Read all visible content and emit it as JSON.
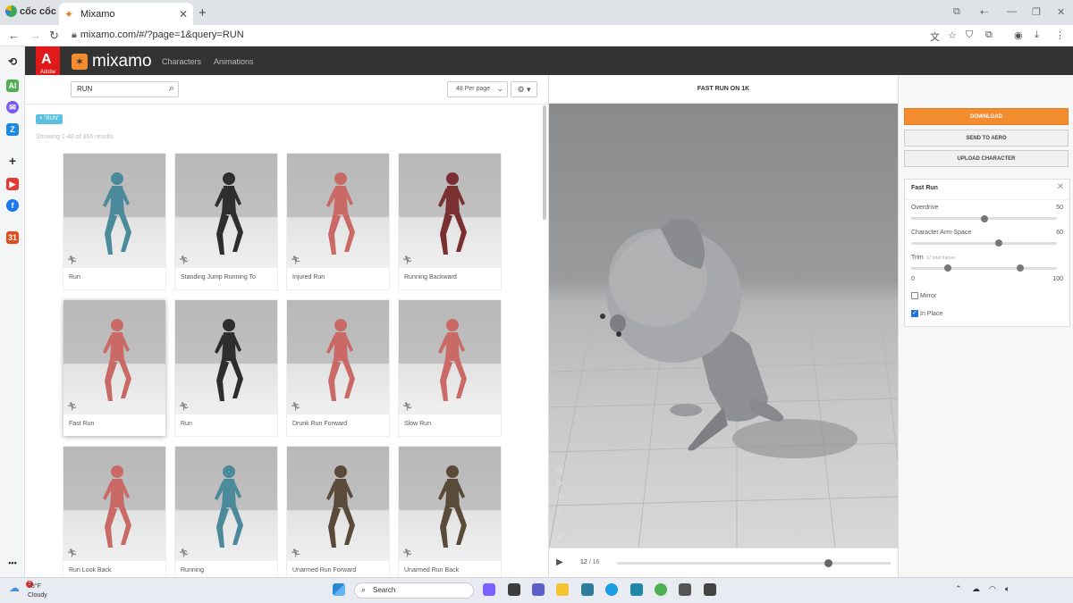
{
  "browser": {
    "brand": "cốc cốc",
    "tab_title": "Mixamo",
    "url": "mixamo.com/#/?page=1&query=RUN"
  },
  "mixamo": {
    "adobe_label": "Adobe",
    "logo_text": "mixamo",
    "nav": [
      "Characters",
      "Animations"
    ]
  },
  "search": {
    "value": "RUN",
    "per_page": "48 Per page"
  },
  "filter_tag": "× \"RUN\"",
  "results_count": "Showing 1-48 of 365 results",
  "cards": [
    {
      "label": "Run",
      "color": "#4a8a9a"
    },
    {
      "label": "Standing Jump Running To",
      "color": "#2e2e2e"
    },
    {
      "label": "Injured Run",
      "color": "#c96a66"
    },
    {
      "label": "Running Backward",
      "color": "#7a3030"
    },
    {
      "label": "Fast Run",
      "color": "#c96a66"
    },
    {
      "label": "Run",
      "color": "#2e2e2e"
    },
    {
      "label": "Drunk Run Forward",
      "color": "#c96a66"
    },
    {
      "label": "Slow Run",
      "color": "#c96a66"
    },
    {
      "label": "Run Look Back",
      "color": "#c96a66"
    },
    {
      "label": "Running",
      "color": "#4a8a9a"
    },
    {
      "label": "Unarmed Run Forward",
      "color": "#5a4a3a"
    },
    {
      "label": "Unarmed Run Back",
      "color": "#5a4a3a"
    }
  ],
  "viewer": {
    "title": "FAST RUN ON 1K",
    "frame_current": "12",
    "frame_total": "/ 16",
    "progress": 0.77
  },
  "actions": {
    "download": "DOWNLOAD",
    "send": "SEND TO AERO",
    "upload": "UPLOAD CHARACTER"
  },
  "properties": {
    "title": "Fast Run",
    "overdrive_label": "Overdrive",
    "overdrive_value": "50",
    "overdrive_level": 0.5,
    "armspace_label": "Character Arm-Space",
    "armspace_value": "60",
    "armspace_level": 0.6,
    "trim_label": "Trim",
    "trim_note": "17 total frames",
    "trim_min": "0",
    "trim_max": "100",
    "trim_start": 0.25,
    "trim_end": 0.75,
    "mirror_label": "Mirror",
    "mirror_checked": false,
    "inplace_label": "In Place",
    "inplace_checked": true
  },
  "taskbar": {
    "temp": "75°F",
    "condition": "Cloudy",
    "badge": "1",
    "search_placeholder": "Search"
  },
  "colors": {
    "accent": "#f28c2f",
    "header": "#333333",
    "tag": "#5bc0de",
    "checkbox": "#1a73e8"
  }
}
